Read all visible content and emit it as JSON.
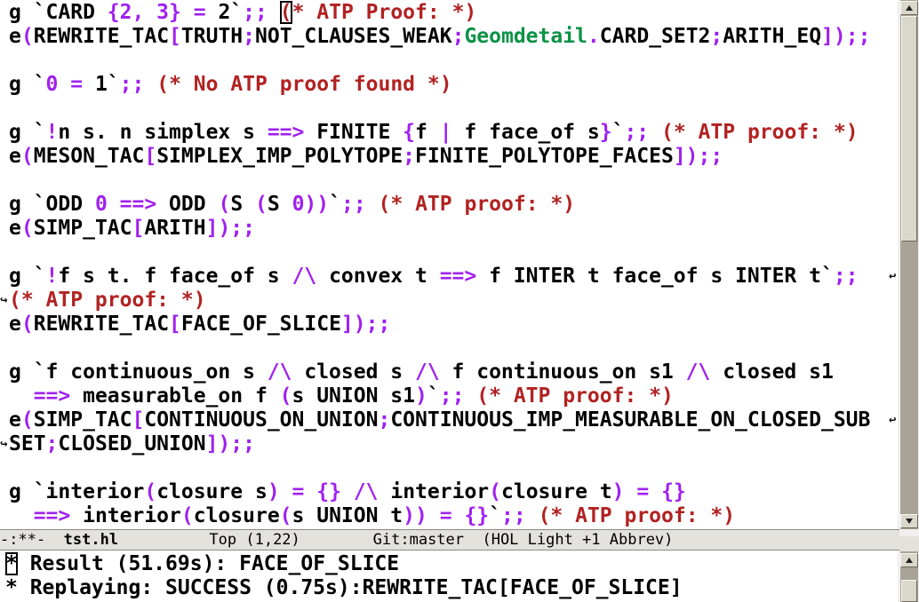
{
  "colors": {
    "black": "#000000",
    "purple": "#a020f0",
    "red": "#b22222",
    "green": "#0a9246",
    "modeline_bg": "#e4e2dd",
    "sb_track": "#a9a396",
    "sb_thumb": "#dad7cb"
  },
  "icons": {
    "wrap_arrow": "↩",
    "scroll_up": "triangle-up",
    "scroll_down": "triangle-down"
  },
  "main_buffer": {
    "lines": [
      {
        "s": [
          {
            "t": "g `CARD ",
            "c": "k"
          },
          {
            "t": "{2, 3}",
            "c": "p"
          },
          {
            "t": " ",
            "c": "k"
          },
          {
            "t": "=",
            "c": "p"
          },
          {
            "t": " 2`",
            "c": "k"
          },
          {
            "t": ";;",
            "c": "p"
          },
          {
            "t": " ",
            "c": "k"
          },
          {
            "t": "(",
            "c": "r",
            "box": true
          },
          {
            "t": "* ATP Proof: *)",
            "c": "r"
          }
        ]
      },
      {
        "s": [
          {
            "t": "e",
            "c": "k"
          },
          {
            "t": "(",
            "c": "p"
          },
          {
            "t": "REWRITE_TAC",
            "c": "k"
          },
          {
            "t": "[",
            "c": "p"
          },
          {
            "t": "TRUTH",
            "c": "k"
          },
          {
            "t": ";",
            "c": "p"
          },
          {
            "t": "NOT_CLAUSES_WEAK",
            "c": "k"
          },
          {
            "t": ";",
            "c": "p"
          },
          {
            "t": "Geomdetail",
            "c": "g"
          },
          {
            "t": ".",
            "c": "p"
          },
          {
            "t": "CARD_SET2",
            "c": "k"
          },
          {
            "t": ";",
            "c": "p"
          },
          {
            "t": "ARITH_EQ",
            "c": "k"
          },
          {
            "t": "]);;",
            "c": "p"
          }
        ]
      },
      {
        "s": []
      },
      {
        "s": [
          {
            "t": "g `",
            "c": "k"
          },
          {
            "t": "0",
            "c": "p"
          },
          {
            "t": " ",
            "c": "k"
          },
          {
            "t": "=",
            "c": "p"
          },
          {
            "t": " 1`",
            "c": "k"
          },
          {
            "t": ";;",
            "c": "p"
          },
          {
            "t": " ",
            "c": "k"
          },
          {
            "t": "(* No ATP proof found *)",
            "c": "r"
          }
        ]
      },
      {
        "s": []
      },
      {
        "s": [
          {
            "t": "g `",
            "c": "k"
          },
          {
            "t": "!",
            "c": "p"
          },
          {
            "t": "n s. n simplex s ",
            "c": "k"
          },
          {
            "t": "==>",
            "c": "p"
          },
          {
            "t": " FINITE ",
            "c": "k"
          },
          {
            "t": "{",
            "c": "p"
          },
          {
            "t": "f ",
            "c": "k"
          },
          {
            "t": "|",
            "c": "p"
          },
          {
            "t": " f face_of s",
            "c": "k"
          },
          {
            "t": "}",
            "c": "p"
          },
          {
            "t": "`",
            "c": "k"
          },
          {
            "t": ";;",
            "c": "p"
          },
          {
            "t": " ",
            "c": "k"
          },
          {
            "t": "(* ATP proof: *)",
            "c": "r"
          }
        ]
      },
      {
        "s": [
          {
            "t": "e",
            "c": "k"
          },
          {
            "t": "(",
            "c": "p"
          },
          {
            "t": "MESON_TAC",
            "c": "k"
          },
          {
            "t": "[",
            "c": "p"
          },
          {
            "t": "SIMPLEX_IMP_POLYTOPE",
            "c": "k"
          },
          {
            "t": ";",
            "c": "p"
          },
          {
            "t": "FINITE_POLYTOPE_FACES",
            "c": "k"
          },
          {
            "t": "]);;",
            "c": "p"
          }
        ]
      },
      {
        "s": []
      },
      {
        "s": [
          {
            "t": "g `ODD ",
            "c": "k"
          },
          {
            "t": "0",
            "c": "p"
          },
          {
            "t": " ",
            "c": "k"
          },
          {
            "t": "==>",
            "c": "p"
          },
          {
            "t": " ODD ",
            "c": "k"
          },
          {
            "t": "(",
            "c": "p"
          },
          {
            "t": "S ",
            "c": "k"
          },
          {
            "t": "(",
            "c": "p"
          },
          {
            "t": "S ",
            "c": "k"
          },
          {
            "t": "0))",
            "c": "p"
          },
          {
            "t": "`",
            "c": "k"
          },
          {
            "t": ";;",
            "c": "p"
          },
          {
            "t": " ",
            "c": "k"
          },
          {
            "t": "(* ATP proof: *)",
            "c": "r"
          }
        ]
      },
      {
        "s": [
          {
            "t": "e",
            "c": "k"
          },
          {
            "t": "(",
            "c": "p"
          },
          {
            "t": "SIMP_TAC",
            "c": "k"
          },
          {
            "t": "[",
            "c": "p"
          },
          {
            "t": "ARITH",
            "c": "k"
          },
          {
            "t": "]);;",
            "c": "p"
          }
        ]
      },
      {
        "s": []
      },
      {
        "wr": true,
        "s": [
          {
            "t": "g `",
            "c": "k"
          },
          {
            "t": "!",
            "c": "p"
          },
          {
            "t": "f s t. f face_of s ",
            "c": "k"
          },
          {
            "t": "/\\",
            "c": "p"
          },
          {
            "t": " convex t ",
            "c": "k"
          },
          {
            "t": "==>",
            "c": "p"
          },
          {
            "t": " f INTER t face_of s INTER t`",
            "c": "k"
          },
          {
            "t": ";;",
            "c": "p"
          }
        ]
      },
      {
        "wl": true,
        "s": [
          {
            "t": "(* ATP proof: *)",
            "c": "r"
          }
        ]
      },
      {
        "s": [
          {
            "t": "e",
            "c": "k"
          },
          {
            "t": "(",
            "c": "p"
          },
          {
            "t": "REWRITE_TAC",
            "c": "k"
          },
          {
            "t": "[",
            "c": "p"
          },
          {
            "t": "FACE_OF_SLICE",
            "c": "k"
          },
          {
            "t": "]);;",
            "c": "p"
          }
        ]
      },
      {
        "s": []
      },
      {
        "s": [
          {
            "t": "g `f continuous_on s ",
            "c": "k"
          },
          {
            "t": "/\\",
            "c": "p"
          },
          {
            "t": " closed s ",
            "c": "k"
          },
          {
            "t": "/\\",
            "c": "p"
          },
          {
            "t": " f continuous_on s1 ",
            "c": "k"
          },
          {
            "t": "/\\",
            "c": "p"
          },
          {
            "t": " closed s1",
            "c": "k"
          }
        ]
      },
      {
        "s": [
          {
            "t": "  ",
            "c": "k"
          },
          {
            "t": "==>",
            "c": "p"
          },
          {
            "t": " measurable_on f ",
            "c": "k"
          },
          {
            "t": "(",
            "c": "p"
          },
          {
            "t": "s UNION s1",
            "c": "k"
          },
          {
            "t": ")",
            "c": "p"
          },
          {
            "t": "`",
            "c": "k"
          },
          {
            "t": ";;",
            "c": "p"
          },
          {
            "t": " ",
            "c": "k"
          },
          {
            "t": "(* ATP proof: *)",
            "c": "r"
          }
        ]
      },
      {
        "wr": true,
        "s": [
          {
            "t": "e",
            "c": "k"
          },
          {
            "t": "(",
            "c": "p"
          },
          {
            "t": "SIMP_TAC",
            "c": "k"
          },
          {
            "t": "[",
            "c": "p"
          },
          {
            "t": "CONTINUOUS_ON_UNION",
            "c": "k"
          },
          {
            "t": ";",
            "c": "p"
          },
          {
            "t": "CONTINUOUS_IMP_MEASURABLE_ON_CLOSED_SUB",
            "c": "k"
          }
        ]
      },
      {
        "wl": true,
        "s": [
          {
            "t": "SET",
            "c": "k"
          },
          {
            "t": ";",
            "c": "p"
          },
          {
            "t": "CLOSED_UNION",
            "c": "k"
          },
          {
            "t": "]);;",
            "c": "p"
          }
        ]
      },
      {
        "s": []
      },
      {
        "s": [
          {
            "t": "g `interior",
            "c": "k"
          },
          {
            "t": "(",
            "c": "p"
          },
          {
            "t": "closure s",
            "c": "k"
          },
          {
            "t": ")",
            "c": "p"
          },
          {
            "t": " ",
            "c": "k"
          },
          {
            "t": "=",
            "c": "p"
          },
          {
            "t": " ",
            "c": "k"
          },
          {
            "t": "{}",
            "c": "p"
          },
          {
            "t": " ",
            "c": "k"
          },
          {
            "t": "/\\",
            "c": "p"
          },
          {
            "t": " interior",
            "c": "k"
          },
          {
            "t": "(",
            "c": "p"
          },
          {
            "t": "closure t",
            "c": "k"
          },
          {
            "t": ")",
            "c": "p"
          },
          {
            "t": " ",
            "c": "k"
          },
          {
            "t": "=",
            "c": "p"
          },
          {
            "t": " ",
            "c": "k"
          },
          {
            "t": "{}",
            "c": "p"
          }
        ]
      },
      {
        "s": [
          {
            "t": "  ",
            "c": "k"
          },
          {
            "t": "==>",
            "c": "p"
          },
          {
            "t": " interior",
            "c": "k"
          },
          {
            "t": "(",
            "c": "p"
          },
          {
            "t": "closure",
            "c": "k"
          },
          {
            "t": "(",
            "c": "p"
          },
          {
            "t": "s UNION t",
            "c": "k"
          },
          {
            "t": "))",
            "c": "p"
          },
          {
            "t": " ",
            "c": "k"
          },
          {
            "t": "=",
            "c": "p"
          },
          {
            "t": " ",
            "c": "k"
          },
          {
            "t": "{}",
            "c": "p"
          },
          {
            "t": "`",
            "c": "k"
          },
          {
            "t": ";;",
            "c": "p"
          },
          {
            "t": " ",
            "c": "k"
          },
          {
            "t": "(* ATP proof: *)",
            "c": "r"
          }
        ]
      }
    ]
  },
  "mode_line": {
    "segments": [
      {
        "t": "-:**-  "
      },
      {
        "t": "tst.hl",
        "bold": true
      },
      {
        "t": "          Top (1,22)        Git:master  (HOL Light +1 Abbrev)"
      }
    ]
  },
  "output_buffer": {
    "lines": [
      {
        "s": [
          {
            "t": "*",
            "c": "k",
            "box": true
          },
          {
            "t": " Result (51.69s): FACE_OF_SLICE",
            "c": "k"
          }
        ]
      },
      {
        "s": [
          {
            "t": "* Replaying: SUCCESS (0.75s):REWRITE_TAC[FACE_OF_SLICE]",
            "c": "k"
          }
        ]
      }
    ]
  }
}
